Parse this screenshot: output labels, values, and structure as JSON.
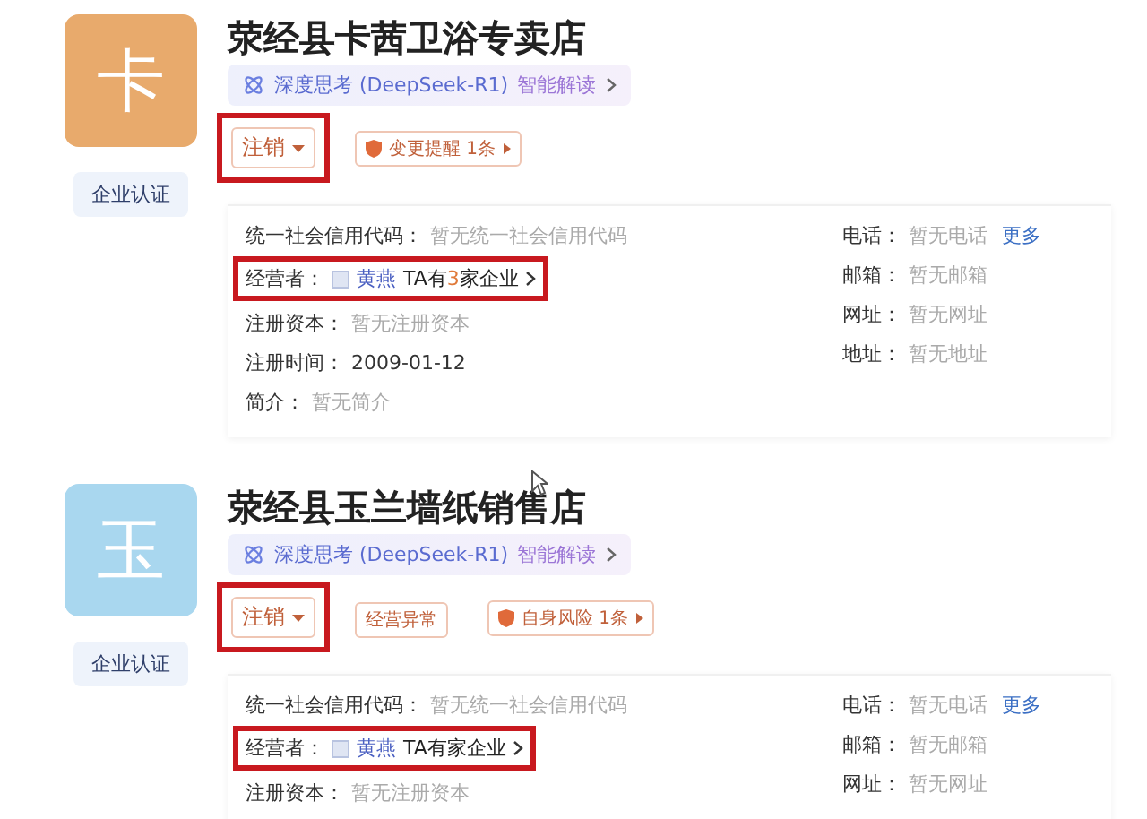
{
  "companies": [
    {
      "logo_char": "卡",
      "color": "#e8aa6c",
      "name": "荥经县卡茜卫浴专卖店",
      "ai_label": "深度思考 (DeepSeek-R1)",
      "ai_action": "智能解读",
      "certify": "企业认证",
      "tags": [
        {
          "kind": "status",
          "label": "注销",
          "highlighted": true
        },
        {
          "kind": "alert",
          "label": "变更提醒",
          "count": "1条",
          "highlighted": false
        }
      ],
      "left": [
        {
          "kind": "text",
          "label": "统一社会信用代码：",
          "value": "暂无统一社会信用代码",
          "empty": true
        },
        {
          "kind": "operator",
          "label": "经营者：",
          "value": "黄燕",
          "prefix": "TA有",
          "count": "3",
          "suffix": "家企业",
          "highlighted": true
        },
        {
          "kind": "text",
          "label": "注册资本：",
          "value": "暂无注册资本",
          "empty": true
        },
        {
          "kind": "text",
          "label": "注册时间：",
          "value": "2009-01-12",
          "empty": false
        },
        {
          "kind": "text",
          "label": "简介：",
          "value": "暂无简介",
          "empty": true
        }
      ],
      "right": [
        {
          "label": "电话：",
          "value": "暂无电话",
          "empty": true,
          "link": "更多"
        },
        {
          "label": "邮箱：",
          "value": "暂无邮箱",
          "empty": true
        },
        {
          "label": "网址：",
          "value": "暂无网址",
          "empty": true
        },
        {
          "label": "地址：",
          "value": "暂无地址",
          "empty": true
        }
      ]
    },
    {
      "logo_char": "玉",
      "color": "#a9d7ef",
      "name": "荥经县玉兰墙纸销售店",
      "ai_label": "深度思考 (DeepSeek-R1)",
      "ai_action": "智能解读",
      "certify": "企业认证",
      "tags": [
        {
          "kind": "status",
          "label": "注销",
          "highlighted": true
        },
        {
          "kind": "plain",
          "label": "经营异常",
          "highlighted": false
        },
        {
          "kind": "alert",
          "label": "自身风险",
          "count": "1条",
          "highlighted": false
        }
      ],
      "left": [
        {
          "kind": "text",
          "label": "统一社会信用代码：",
          "value": "暂无统一社会信用代码",
          "empty": true
        },
        {
          "kind": "operator",
          "label": "经营者：",
          "value": "黄燕",
          "prefix": "TA有",
          "suffix": "家企业",
          "highlighted": true
        },
        {
          "kind": "text",
          "label": "注册资本：",
          "value": "暂无注册资本",
          "empty": true
        }
      ],
      "right": [
        {
          "label": "电话：",
          "value": "暂无电话",
          "empty": true,
          "link": "更多"
        },
        {
          "label": "邮箱：",
          "value": "暂无邮箱",
          "empty": true
        },
        {
          "label": "网址：",
          "value": "暂无网址",
          "empty": true
        }
      ]
    }
  ]
}
